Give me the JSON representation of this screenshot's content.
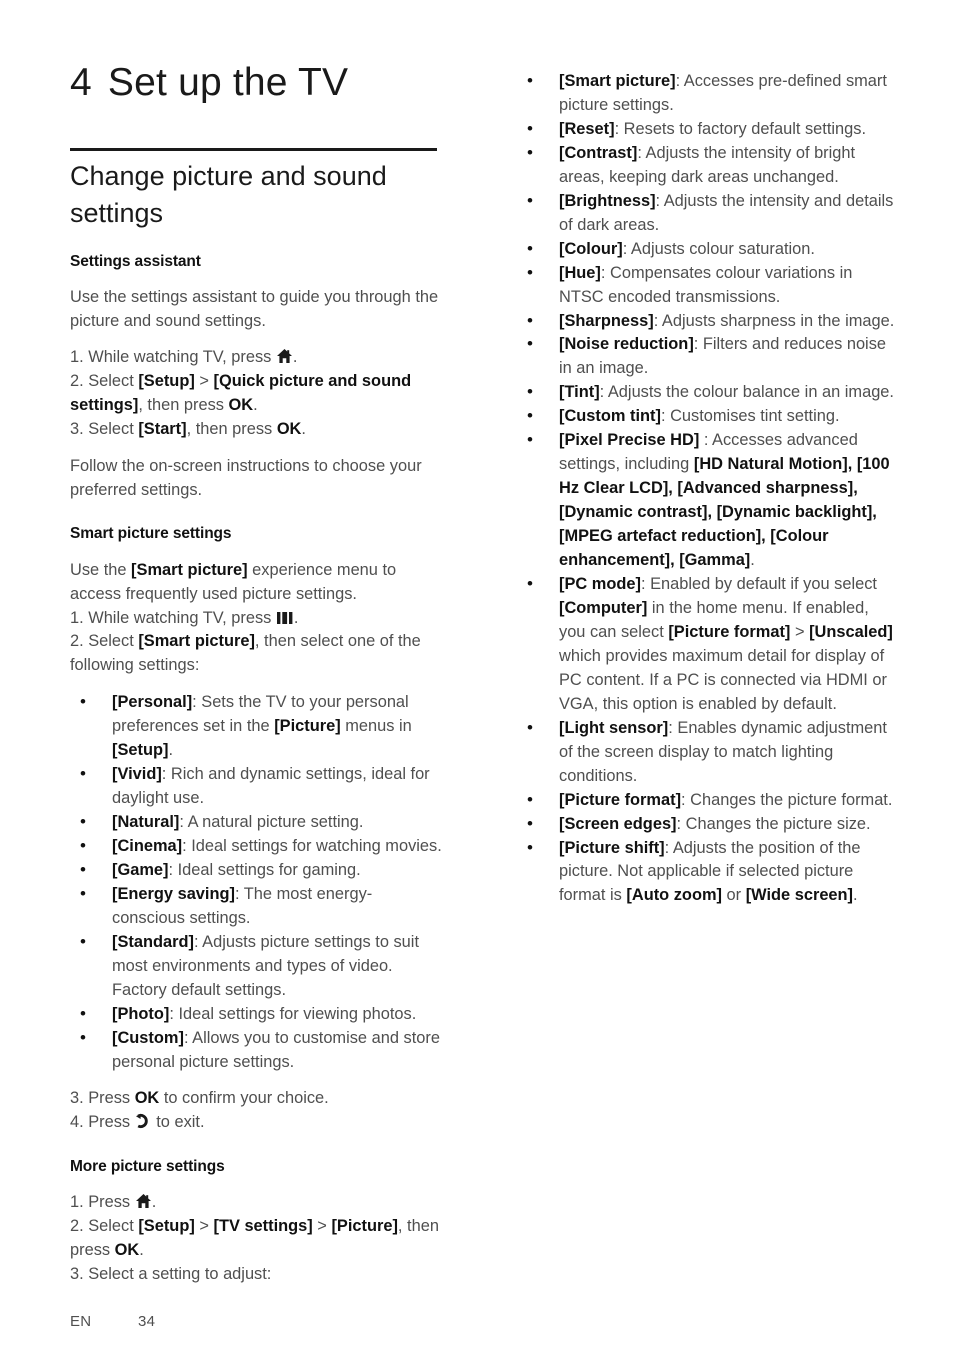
{
  "document": {
    "chapter_number": "4",
    "chapter_title": "Set up the TV",
    "section_title": "Change picture and sound settings"
  },
  "icons": {
    "home": "home-icon",
    "options": "options-bars-icon",
    "back": "back-arrow-icon"
  },
  "left_column": {
    "settings_assistant": {
      "heading": "Settings assistant",
      "intro": "Use the settings assistant to guide you through the picture and sound settings.",
      "step1_pre": "1. While watching TV, press ",
      "step1_post": ".",
      "step2": {
        "pre": "2. Select ",
        "b1": "[Setup]",
        "mid": " > ",
        "b2": "[Quick picture and sound settings]",
        "post": ", then press ",
        "b3": "OK",
        "end": "."
      },
      "step3": {
        "pre": "3. Select ",
        "b1": "[Start]",
        "post": ", then press ",
        "b2": "OK",
        "end": "."
      },
      "outro": "Follow the on-screen instructions to choose your preferred settings."
    },
    "smart_picture": {
      "heading": "Smart picture settings",
      "intro": {
        "pre": "Use the ",
        "b1": "[Smart picture]",
        "post": " experience menu to access frequently used picture settings."
      },
      "step1_pre": "1. While watching TV, press ",
      "step1_post": ".",
      "step2": {
        "pre": "2. Select ",
        "b1": "[Smart picture]",
        "post": ", then select one of the following settings:"
      },
      "items": [
        {
          "term": "[Personal]",
          "desc_pre": ": Sets the TV to your personal preferences set in the ",
          "b2": "[Picture]",
          "desc_mid": " menus in ",
          "b3": "[Setup]",
          "desc_end": "."
        },
        {
          "term": "[Vivid]",
          "desc": ": Rich and dynamic settings, ideal for daylight use."
        },
        {
          "term": "[Natural]",
          "desc": ": A natural picture setting."
        },
        {
          "term": "[Cinema]",
          "desc": ": Ideal settings for watching movies."
        },
        {
          "term": "[Game]",
          "desc": ": Ideal settings for gaming."
        },
        {
          "term": "[Energy saving]",
          "desc": ": The most energy-conscious settings."
        },
        {
          "term": "[Standard]",
          "desc": ": Adjusts picture settings to suit most environments and types of video. Factory default settings."
        },
        {
          "term": "[Photo]",
          "desc": ": Ideal settings for viewing photos."
        },
        {
          "term": "[Custom]",
          "desc": ": Allows you to customise and store personal picture settings."
        }
      ],
      "step3": {
        "pre": "3. Press ",
        "b1": "OK",
        "post": " to confirm your choice."
      },
      "step4": {
        "pre": "4. Press ",
        "post": " to exit."
      }
    },
    "more_picture": {
      "heading": "More picture settings",
      "step1_pre": "1. Press ",
      "step1_post": ".",
      "step2": {
        "pre": "2. Select ",
        "b1": "[Setup]",
        "mid1": " > ",
        "b2": "[TV settings]",
        "mid2": " > ",
        "b3": "[Picture]",
        "post": ", then press ",
        "b4": "OK",
        "end": "."
      },
      "step3": "3. Select a setting to adjust:"
    }
  },
  "right_column": {
    "items": [
      {
        "term": "[Smart picture]",
        "desc": ": Accesses pre-defined smart picture settings."
      },
      {
        "term": "[Reset]",
        "desc": ": Resets to factory default settings."
      },
      {
        "term": "[Contrast]",
        "desc": ": Adjusts the intensity of bright areas, keeping dark areas unchanged."
      },
      {
        "term": "[Brightness]",
        "desc": ": Adjusts the intensity and details of dark areas."
      },
      {
        "term": "[Colour]",
        "desc": ": Adjusts colour saturation."
      },
      {
        "term": "[Hue]",
        "desc": ": Compensates colour variations in NTSC encoded transmissions."
      },
      {
        "term": "[Sharpness]",
        "desc": ": Adjusts sharpness in the image."
      },
      {
        "term": "[Noise reduction]",
        "desc": ": Filters and reduces noise in an image."
      },
      {
        "term": "[Tint]",
        "desc": ": Adjusts the colour balance in an image."
      },
      {
        "term": "[Custom tint]",
        "desc": ": Customises tint setting."
      }
    ],
    "pixel_precise": {
      "term": "[Pixel Precise HD]",
      "desc_pre": " : Accesses advanced settings, including ",
      "sublist": "[HD Natural Motion], [100 Hz Clear LCD], [Advanced sharpness], [Dynamic contrast], [Dynamic backlight], [MPEG artefact reduction], [Colour enhancement], [Gamma]",
      "desc_end": "."
    },
    "pc_mode": {
      "term": "[PC mode]",
      "p1": ": Enabled by default if you select ",
      "b1": "[Computer]",
      "p2": " in the home menu. If enabled, you can select ",
      "b2": "[Picture format]",
      "p3": " > ",
      "b3": "[Unscaled]",
      "p4": " which provides maximum detail for display of PC content. If a PC is connected via HDMI or VGA, this option is enabled by default."
    },
    "items_tail": [
      {
        "term": "[Light sensor]",
        "desc": ": Enables dynamic adjustment of the screen display to match lighting conditions."
      },
      {
        "term": "[Picture format]",
        "desc": ": Changes the picture format."
      },
      {
        "term": "[Screen edges]",
        "desc": ": Changes the picture size."
      }
    ],
    "picture_shift": {
      "term": "[Picture shift]",
      "p1": ": Adjusts the position of the picture. Not applicable if selected picture format is ",
      "b1": "[Auto zoom]",
      "p2": " or ",
      "b2": "[Wide screen]",
      "p3": "."
    }
  },
  "footer": {
    "language": "EN",
    "page_number": "34"
  }
}
